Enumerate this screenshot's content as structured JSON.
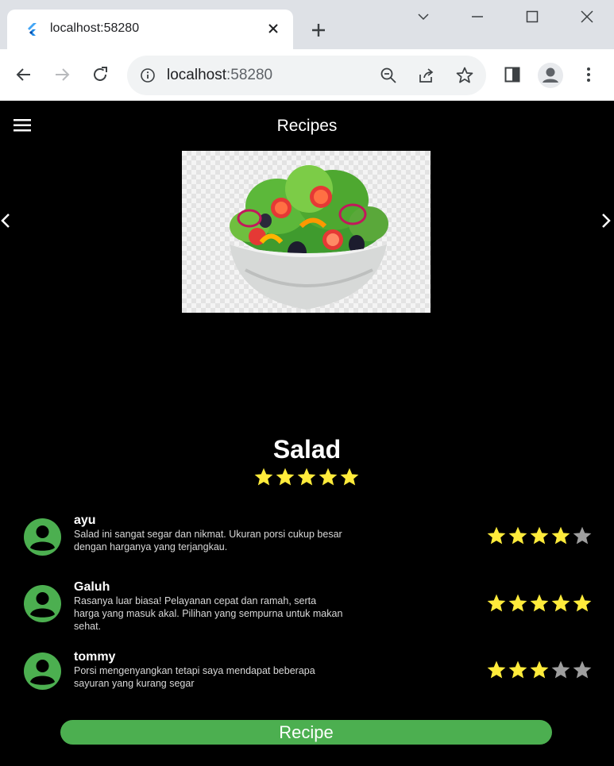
{
  "browser": {
    "tab_title": "localhost:58280",
    "url_host": "localhost",
    "url_port": ":58280"
  },
  "app": {
    "title": "Recipes",
    "recipe_name": "Salad",
    "rating": 5,
    "button_label": "Recipe",
    "accent_color": "#4caf50",
    "star_color": "#ffeb3b"
  },
  "reviews": [
    {
      "name": "ayu",
      "text": "Salad ini sangat segar dan nikmat. Ukuran porsi cukup besar dengan harganya yang terjangkau.",
      "rating": 4
    },
    {
      "name": "Galuh",
      "text": "Rasanya luar biasa! Pelayanan cepat dan ramah, serta harga yang masuk akal. Pilihan yang sempurna untuk makan sehat.",
      "rating": 5
    },
    {
      "name": "tommy",
      "text": "Porsi mengenyangkan tetapi saya mendapat beberapa sayuran yang kurang segar",
      "rating": 3
    }
  ]
}
